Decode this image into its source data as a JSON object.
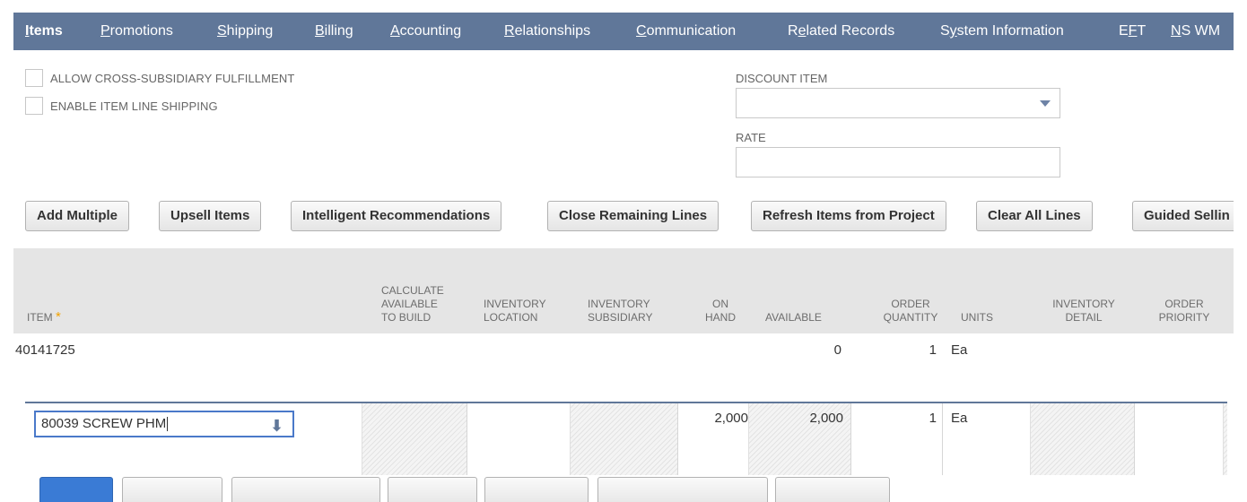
{
  "tabs": [
    {
      "pre": "",
      "u": "I",
      "post": "tems"
    },
    {
      "pre": "",
      "u": "P",
      "post": "romotions"
    },
    {
      "pre": "",
      "u": "S",
      "post": "hipping"
    },
    {
      "pre": "",
      "u": "B",
      "post": "illing"
    },
    {
      "pre": "",
      "u": "A",
      "post": "ccounting"
    },
    {
      "pre": "",
      "u": "R",
      "post": "elationships"
    },
    {
      "pre": "",
      "u": "C",
      "post": "ommunication"
    },
    {
      "pre": "R",
      "u": "e",
      "post": "lated Records"
    },
    {
      "pre": "S",
      "u": "y",
      "post": "stem Information"
    },
    {
      "pre": "E",
      "u": "F",
      "post": "T"
    },
    {
      "pre": "",
      "u": "N",
      "post": "S WM"
    }
  ],
  "options": {
    "allow_cross": "ALLOW CROSS-SUBSIDIARY FULFILLMENT",
    "enable_line_shipping": "ENABLE ITEM LINE SHIPPING"
  },
  "discount": {
    "label": "DISCOUNT ITEM",
    "value": "",
    "rate_label": "RATE",
    "rate_value": ""
  },
  "buttons": {
    "add_multiple": "Add Multiple",
    "upsell": "Upsell Items",
    "intelligent": "Intelligent Recommendations",
    "close_remaining": "Close Remaining Lines",
    "refresh": "Refresh Items from Project",
    "clear_all": "Clear All Lines",
    "guided": "Guided Sellin"
  },
  "columns": {
    "item": "ITEM",
    "calc_l1": "CALCULATE",
    "calc_l2": "AVAILABLE",
    "calc_l3": "TO BUILD",
    "invloc_l1": "INVENTORY",
    "invloc_l2": "LOCATION",
    "invsub_l1": "INVENTORY",
    "invsub_l2": "SUBSIDIARY",
    "onhand_l1": "ON",
    "onhand_l2": "HAND",
    "available": "AVAILABLE",
    "orderqty_l1": "ORDER",
    "orderqty_l2": "QUANTITY",
    "units": "UNITS",
    "invdet_l1": "INVENTORY",
    "invdet_l2": "DETAIL",
    "orderpri_l1": "ORDER",
    "orderpri_l2": "PRIORITY"
  },
  "rows": [
    {
      "item": "40141725",
      "available": "0",
      "order_qty": "1",
      "units": "Ea"
    }
  ],
  "edit_row": {
    "item": "80039 SCREW PHM",
    "on_hand": "2,000",
    "available": "2,000",
    "order_qty": "1",
    "units": "Ea"
  }
}
